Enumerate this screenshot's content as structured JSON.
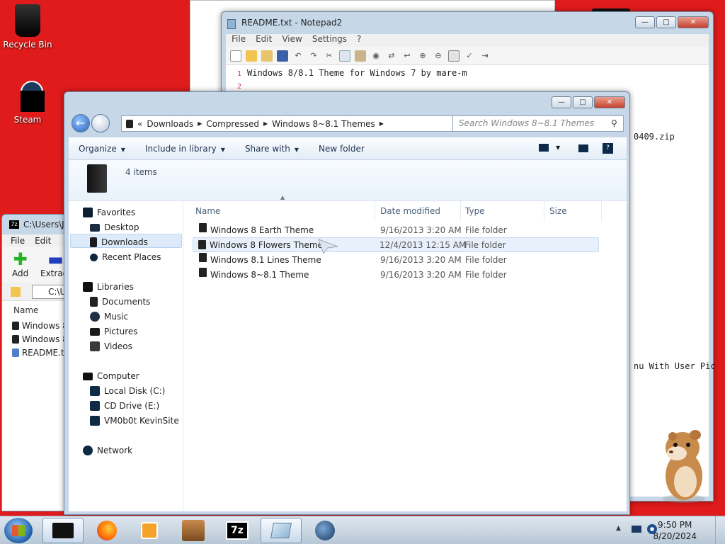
{
  "desktop": {
    "icons": [
      {
        "label": "Recycle Bin",
        "icon": "recycle-bin-icon"
      },
      {
        "label": "Steam",
        "icon": "steam-icon"
      }
    ]
  },
  "notepad": {
    "title": "README.txt - Notepad2",
    "menu": [
      "File",
      "Edit",
      "View",
      "Settings",
      "?"
    ],
    "line1_num": "1",
    "line1": "Windows 8/8.1 Theme for Windows 7 by mare-m",
    "line2_num": "2",
    "snippet_zip": "0409.zip",
    "snippet_menu": "nu With User Pic"
  },
  "sevenzip": {
    "title": "C:\\Users\\Jo",
    "menu": [
      "File",
      "Edit"
    ],
    "add_label": "Add",
    "extract_label": "Extract",
    "path": "C:\\U",
    "col_name": "Name",
    "items": [
      "Windows 8",
      "Windows 8",
      "README.tx"
    ]
  },
  "explorer": {
    "breadcrumb": [
      "Downloads",
      "Compressed",
      "Windows 8~8.1 Themes"
    ],
    "search_placeholder": "Search Windows 8~8.1 Themes",
    "commands": {
      "organize": "Organize",
      "include": "Include in library",
      "share": "Share with",
      "newfolder": "New folder"
    },
    "item_count": "4 items",
    "nav": {
      "favorites": "Favorites",
      "desktop": "Desktop",
      "downloads": "Downloads",
      "recent": "Recent Places",
      "libraries": "Libraries",
      "documents": "Documents",
      "music": "Music",
      "pictures": "Pictures",
      "videos": "Videos",
      "computer": "Computer",
      "localdisk": "Local Disk (C:)",
      "cddrive": "CD Drive (E:)",
      "vm": "VM0b0t KevinSite",
      "network": "Network"
    },
    "columns": {
      "name": "Name",
      "date": "Date modified",
      "type": "Type",
      "size": "Size"
    },
    "files": [
      {
        "name": "Windows 8 Earth Theme",
        "date": "9/16/2013 3:20 AM",
        "type": "File folder"
      },
      {
        "name": "Windows 8 Flowers Theme",
        "date": "12/4/2013 12:15 AM",
        "type": "File folder"
      },
      {
        "name": "Windows 8.1 Lines Theme",
        "date": "9/16/2013 3:20 AM",
        "type": "File folder"
      },
      {
        "name": "Windows 8~8.1 Theme",
        "date": "9/16/2013 3:20 AM",
        "type": "File folder"
      }
    ]
  },
  "taskbar": {
    "zip_label": "7z",
    "time": "9:50 PM",
    "date": "8/20/2024"
  }
}
